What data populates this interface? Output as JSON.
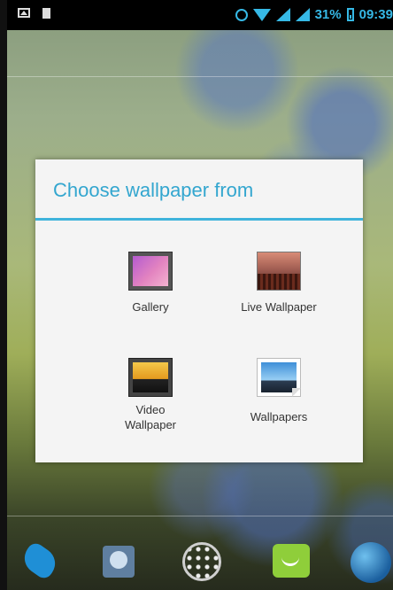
{
  "status_bar": {
    "battery_percent": "31%",
    "time": "09:39",
    "icons": [
      "image-icon",
      "sd-card-icon",
      "alarm-icon",
      "wifi-icon",
      "signal-icon",
      "signal-icon",
      "battery-icon"
    ]
  },
  "dialog": {
    "title": "Choose wallpaper from",
    "accent_color": "#33a6cf",
    "options": [
      {
        "label": "Gallery",
        "icon": "gallery-icon"
      },
      {
        "label": "Live Wallpaper",
        "icon": "live-wallpaper-icon"
      },
      {
        "label": "Video\nWallpaper",
        "icon": "video-wallpaper-icon"
      },
      {
        "label": "Wallpapers",
        "icon": "wallpapers-icon"
      }
    ]
  },
  "dock": {
    "items": [
      "phone-icon",
      "contacts-icon",
      "app-drawer-icon",
      "messaging-icon",
      "browser-icon"
    ]
  }
}
